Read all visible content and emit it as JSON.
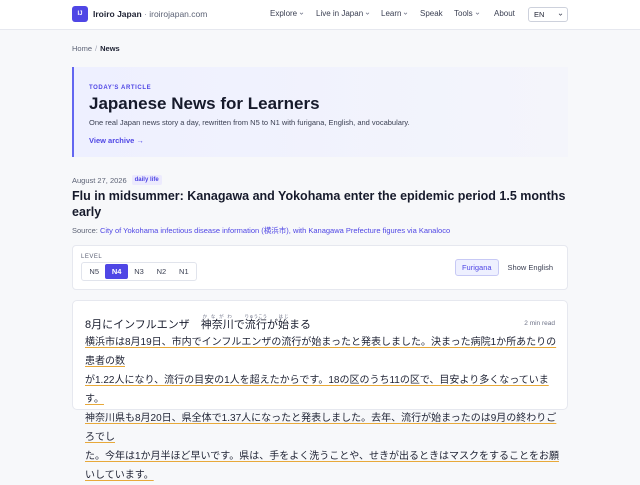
{
  "header": {
    "logo": "IJ",
    "brand_name": "Iroiro Japan",
    "brand_sep": " · ",
    "brand_domain": "iroirojapan.com",
    "nav": [
      {
        "label": "Explore",
        "dropdown": true
      },
      {
        "label": "Live in Japan",
        "dropdown": true
      },
      {
        "label": "Learn",
        "dropdown": true
      },
      {
        "label": "Speak",
        "dropdown": false
      },
      {
        "label": "Tools",
        "dropdown": true
      },
      {
        "label": "About",
        "dropdown": false
      }
    ],
    "language": "EN"
  },
  "breadcrumb": {
    "home": "Home",
    "current": "News"
  },
  "hero": {
    "kicker": "TODAY'S ARTICLE",
    "title": "Japanese News for Learners",
    "description": "One real Japan news story a day, rewritten from N5 to N1 with furigana, English, and vocabulary.",
    "archive_link": "View archive →"
  },
  "article_meta": {
    "date": "August 27, 2026",
    "tag": "daily life",
    "headline": "Flu in midsummer: Kanagawa and Yokohama enter the epidemic period 1.5 months early",
    "source_label": "Source: ",
    "source_link": "City of Yokohama infectious disease information (横浜市), with Kanagawa Prefecture figures via Kanaloco"
  },
  "controls": {
    "level_label": "LEVEL",
    "levels": [
      "N5",
      "N4",
      "N3",
      "N2",
      "N1"
    ],
    "active_level": "N4",
    "furigana_label": "Furigana",
    "show_english_label": "Show English"
  },
  "article": {
    "title_prefix": "8月にインフルエンザ　",
    "title_ruby": [
      {
        "base": "神奈川",
        "rt": "かながわ"
      },
      {
        "base": "で",
        "rt": ""
      },
      {
        "base": "流行",
        "rt": "りゅうこう"
      },
      {
        "base": "が",
        "rt": ""
      },
      {
        "base": "始",
        "rt": "はじ"
      },
      {
        "base": "まる",
        "rt": ""
      }
    ],
    "read_time": "2 min read",
    "line1": "横浜市は8月19日、市内でインフルエンザの流行が始まったと発表しました。決まった病院1か所あたりの患者の数",
    "line2": "が1.22人になり、流行の目安の1人を超えたからです。18の区のうち11の区で、目安より多くなっています。",
    "line3": "神奈川県も8月20日、県全体で1.37人になったと発表しました。去年、流行が始まったのは9月の終わりごろでし",
    "line4": "た。今年は1か月半ほど早いです。県は、手をよく洗うことや、せきが出るときはマスクをすることをお願いしています。"
  }
}
